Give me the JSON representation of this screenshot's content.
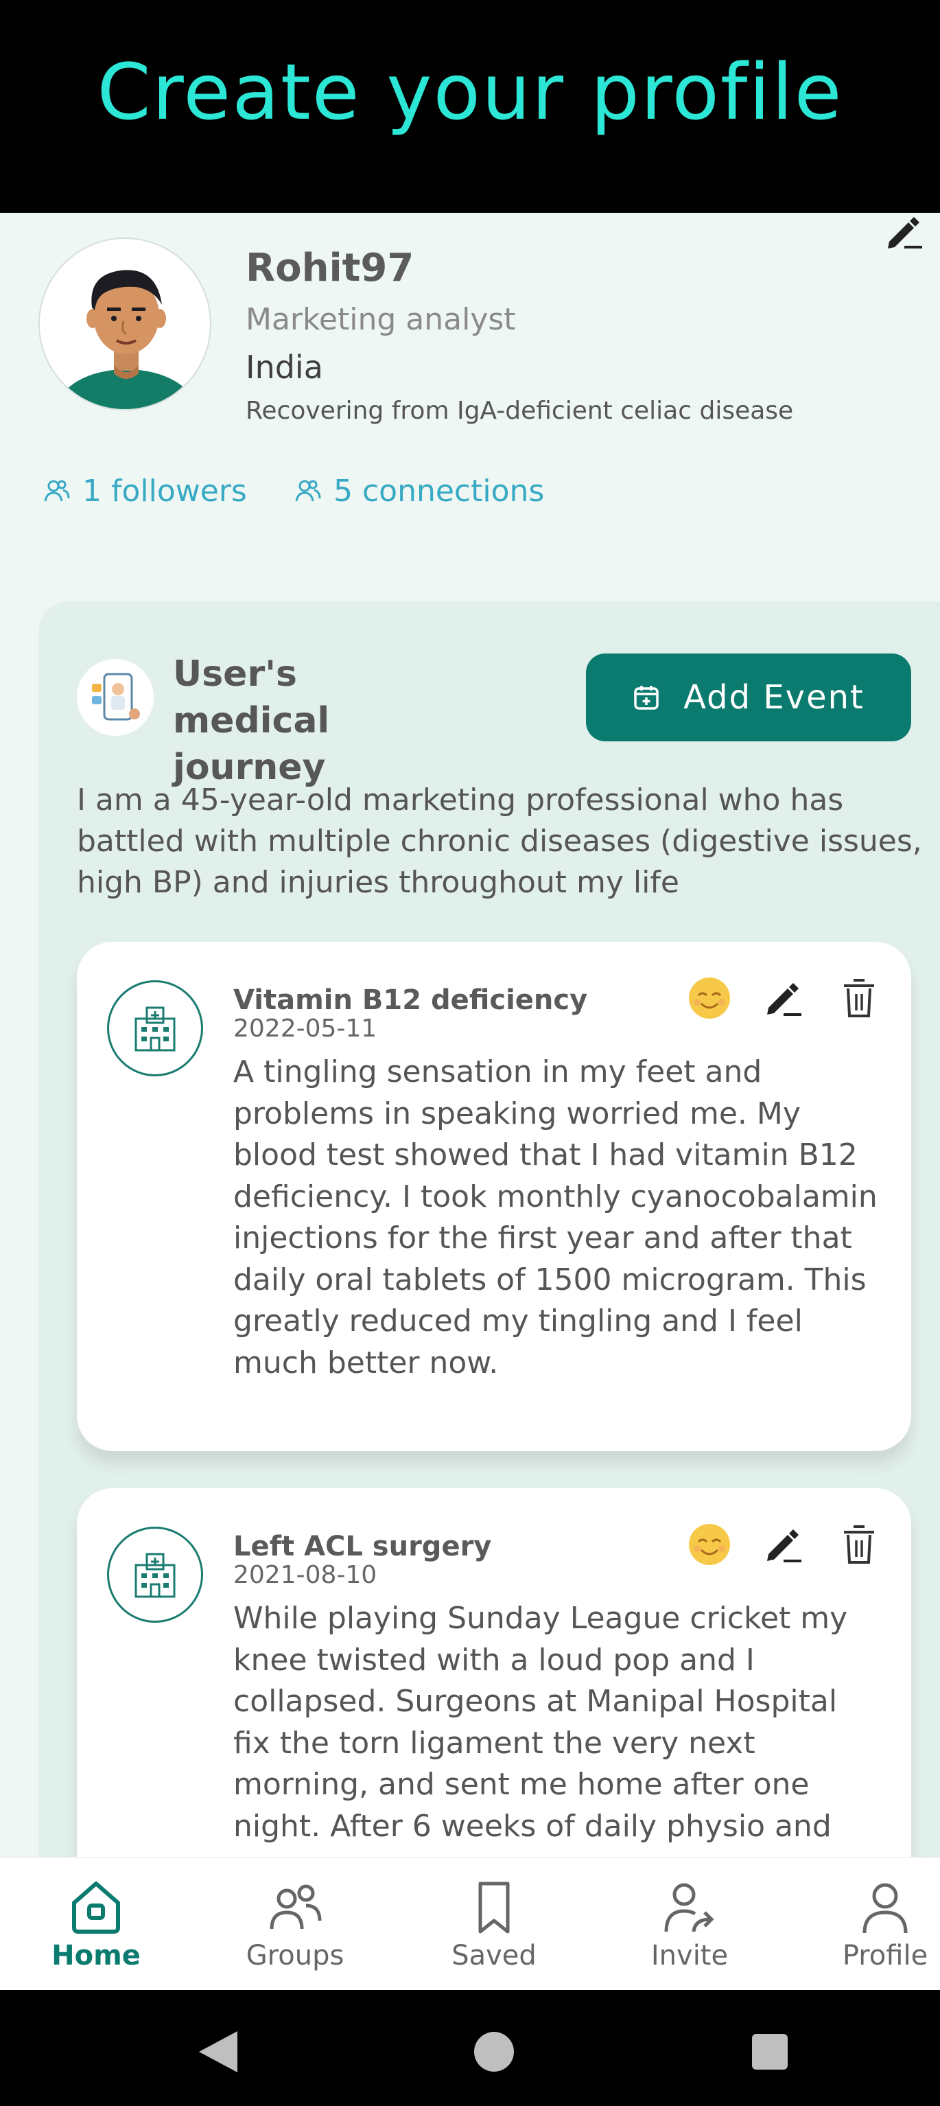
{
  "banner": {
    "title": "Create your profile"
  },
  "profile": {
    "username": "Rohit97",
    "job": "Marketing analyst",
    "country": "India",
    "condition": "Recovering from IgA-deficient celiac disease",
    "followers": "1 followers",
    "connections": "5 connections"
  },
  "journey": {
    "title": "User's medical journey",
    "add_event_label": "Add Event",
    "description": "I am a 45-year-old marketing professional who has battled with multiple chronic diseases (digestive issues, high BP) and injuries throughout my life"
  },
  "events": [
    {
      "title": "Vitamin B12 deficiency",
      "date": "2022-05-11",
      "body": "A tingling sensation in my feet and problems in speaking worried me. My blood test showed that I had vitamin B12 deficiency. I took monthly cyanocobalamin injections for the first year and after that daily oral tablets of 1500 microgram. This greatly reduced my tingling and I feel much better now."
    },
    {
      "title": "Left ACL surgery",
      "date": "2021-08-10",
      "body": "While playing Sunday League cricket my knee twisted with a loud pop and I collapsed. Surgeons at Manipal Hospital fix the torn ligament the very next morning, and sent me home after one night. After 6 weeks of daily physio and"
    }
  ],
  "nav": {
    "home": "Home",
    "groups": "Groups",
    "saved": "Saved",
    "invite": "Invite",
    "profile": "Profile"
  },
  "colors": {
    "accent": "#0b7b6f",
    "link": "#38a9c4",
    "banner_text": "#2ce6d6",
    "background": "#eef7f3"
  },
  "icons": {
    "edit": "pencil-icon",
    "delete": "trash-icon",
    "mood": "smiley-icon",
    "event": "hospital-icon",
    "add": "calendar-plus-icon"
  }
}
